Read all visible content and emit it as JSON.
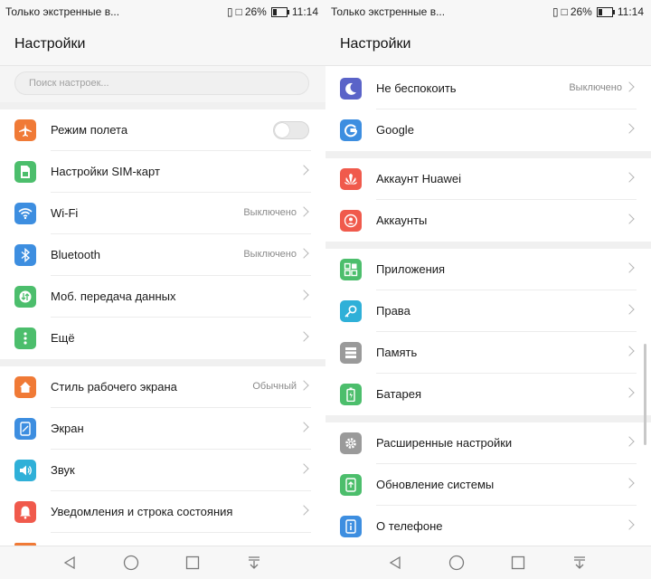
{
  "status_bar": {
    "carrier": "Только экстренные в...",
    "battery": "26%",
    "time": "11:14"
  },
  "header_title": "Настройки",
  "search_placeholder": "Поиск настроек...",
  "left_items": [
    {
      "label": "Режим полета",
      "value": "",
      "icon": "airplane-icon",
      "color": "#f07a36"
    },
    {
      "label": "Настройки SIM-карт",
      "value": "",
      "icon": "sim-card-icon",
      "color": "#4cbe6c"
    },
    {
      "label": "Wi-Fi",
      "value": "Выключено",
      "icon": "wifi-icon",
      "color": "#3d8ee0"
    },
    {
      "label": "Bluetooth",
      "value": "Выключено",
      "icon": "bluetooth-icon",
      "color": "#3d8ee0"
    },
    {
      "label": "Моб. передача данных",
      "value": "",
      "icon": "mobile-data-icon",
      "color": "#4cbe6c"
    },
    {
      "label": "Ещё",
      "value": "",
      "icon": "more-icon",
      "color": "#4cbe6c"
    },
    {
      "label": "Стиль рабочего экрана",
      "value": "Обычный",
      "icon": "home-icon",
      "color": "#f07a36"
    },
    {
      "label": "Экран",
      "value": "",
      "icon": "display-icon",
      "color": "#3d8ee0"
    },
    {
      "label": "Звук",
      "value": "",
      "icon": "sound-icon",
      "color": "#2fb0d8"
    },
    {
      "label": "Уведомления и строка состояния",
      "value": "",
      "icon": "bell-icon",
      "color": "#f05a4c"
    }
  ],
  "right_items": [
    {
      "label": "Не беспокоить",
      "value": "Выключено",
      "icon": "moon-icon",
      "color": "#5a63c8"
    },
    {
      "label": "Google",
      "value": "",
      "icon": "google-icon",
      "color": "#3d8ee0"
    },
    {
      "label": "Аккаунт Huawei",
      "value": "",
      "icon": "huawei-icon",
      "color": "#f05a4c"
    },
    {
      "label": "Аккаунты",
      "value": "",
      "icon": "account-icon",
      "color": "#f05a4c"
    },
    {
      "label": "Приложения",
      "value": "",
      "icon": "apps-icon",
      "color": "#4cbe6c"
    },
    {
      "label": "Права",
      "value": "",
      "icon": "key-icon",
      "color": "#2fb0d8"
    },
    {
      "label": "Память",
      "value": "",
      "icon": "storage-icon",
      "color": "#9a9a9a"
    },
    {
      "label": "Батарея",
      "value": "",
      "icon": "battery-icon",
      "color": "#4cbe6c"
    },
    {
      "label": "Расширенные настройки",
      "value": "",
      "icon": "advanced-settings-icon",
      "color": "#9a9a9a"
    },
    {
      "label": "Обновление системы",
      "value": "",
      "icon": "system-update-icon",
      "color": "#4cbe6c"
    },
    {
      "label": "О телефоне",
      "value": "",
      "icon": "info-icon",
      "color": "#3d8ee0"
    }
  ]
}
